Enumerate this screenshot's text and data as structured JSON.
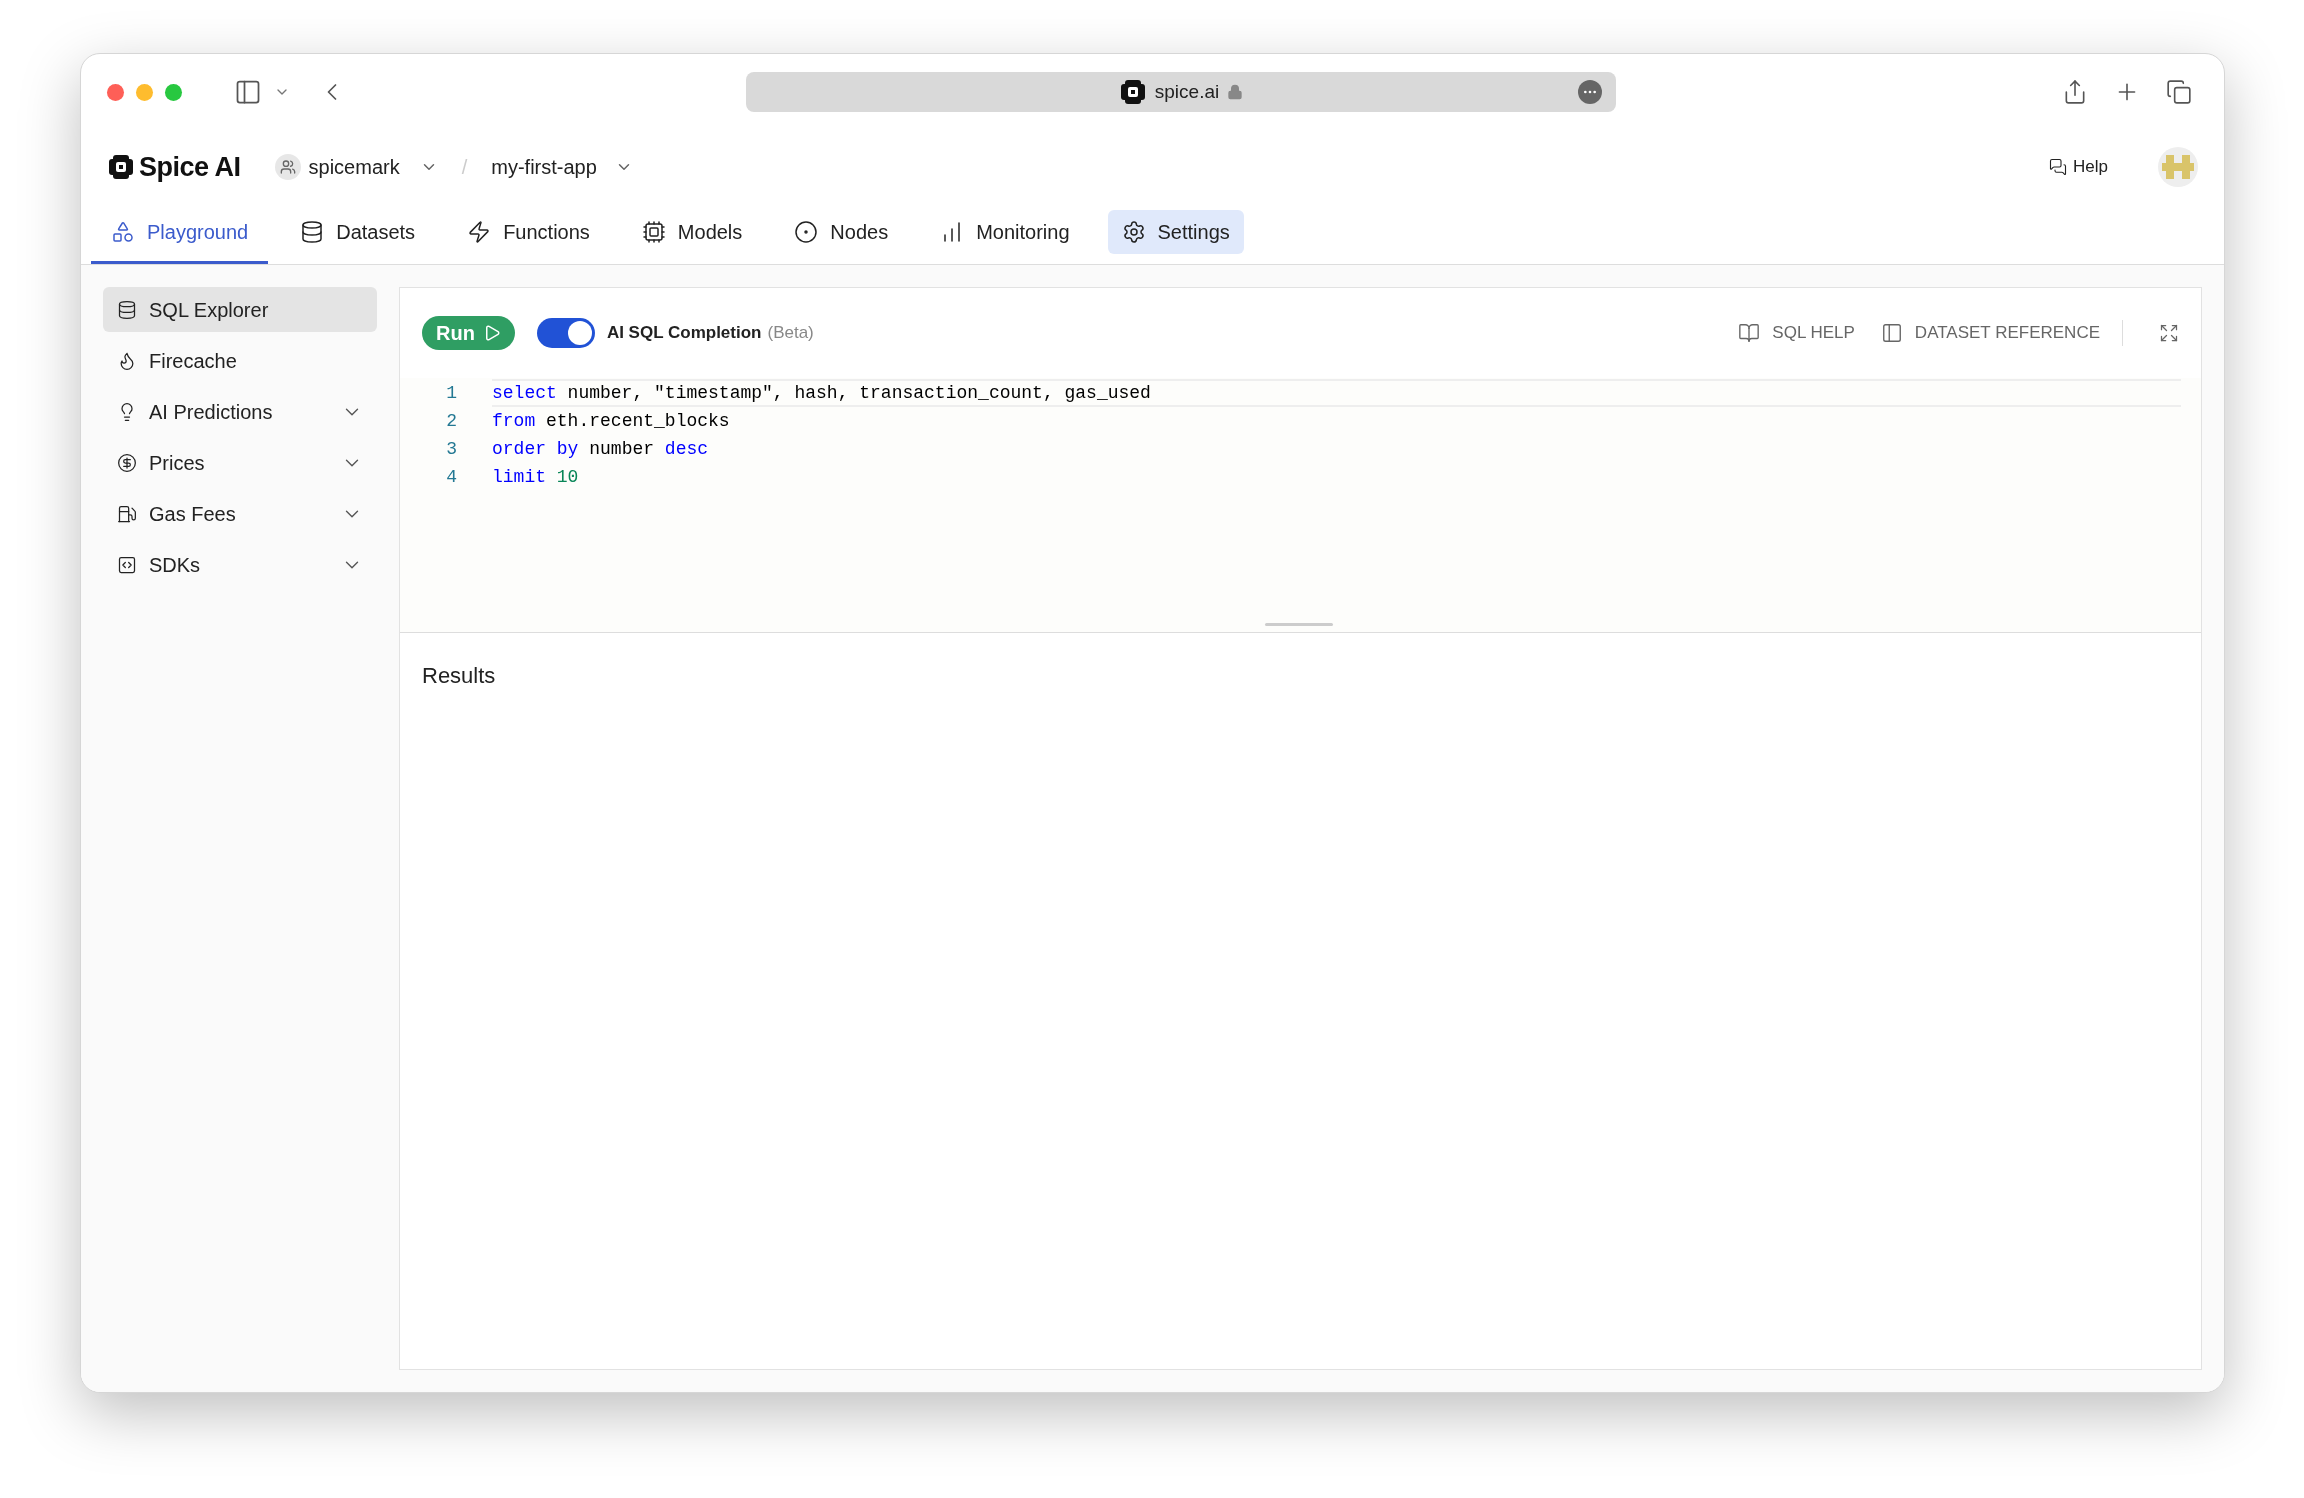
{
  "browser": {
    "address": "spice.ai"
  },
  "header": {
    "brand": "Spice AI",
    "org": "spicemark",
    "separator": "/",
    "app": "my-first-app",
    "help": "Help"
  },
  "tabs": [
    {
      "label": "Playground",
      "selected": true,
      "highlighted": false
    },
    {
      "label": "Datasets",
      "selected": false,
      "highlighted": false
    },
    {
      "label": "Functions",
      "selected": false,
      "highlighted": false
    },
    {
      "label": "Models",
      "selected": false,
      "highlighted": false
    },
    {
      "label": "Nodes",
      "selected": false,
      "highlighted": false
    },
    {
      "label": "Monitoring",
      "selected": false,
      "highlighted": false
    },
    {
      "label": "Settings",
      "selected": false,
      "highlighted": true
    }
  ],
  "sidebar": {
    "items": [
      {
        "label": "SQL Explorer",
        "selected": true,
        "expandable": false
      },
      {
        "label": "Firecache",
        "selected": false,
        "expandable": false
      },
      {
        "label": "AI Predictions",
        "selected": false,
        "expandable": true
      },
      {
        "label": "Prices",
        "selected": false,
        "expandable": true
      },
      {
        "label": "Gas Fees",
        "selected": false,
        "expandable": true
      },
      {
        "label": "SDKs",
        "selected": false,
        "expandable": true
      }
    ]
  },
  "editor": {
    "run": "Run",
    "completion": {
      "label": "AI SQL Completion",
      "note": "(Beta)",
      "on": true
    },
    "links": [
      "SQL HELP",
      "DATASET REFERENCE"
    ],
    "lines": [
      {
        "number": "1",
        "current": true,
        "tokens": [
          {
            "kind": "keyword",
            "text": "select"
          },
          {
            "kind": "plain",
            "text": " number, \"timestamp\", hash, transaction_count, gas_used"
          }
        ]
      },
      {
        "number": "2",
        "current": false,
        "tokens": [
          {
            "kind": "keyword",
            "text": "from"
          },
          {
            "kind": "plain",
            "text": " eth.recent_blocks"
          }
        ]
      },
      {
        "number": "3",
        "current": false,
        "tokens": [
          {
            "kind": "keyword",
            "text": "order by"
          },
          {
            "kind": "plain",
            "text": " number "
          },
          {
            "kind": "keyword",
            "text": "desc"
          }
        ]
      },
      {
        "number": "4",
        "current": false,
        "tokens": [
          {
            "kind": "keyword",
            "text": "limit "
          },
          {
            "kind": "number",
            "text": "10"
          }
        ]
      }
    ]
  },
  "results": {
    "title": "Results"
  }
}
